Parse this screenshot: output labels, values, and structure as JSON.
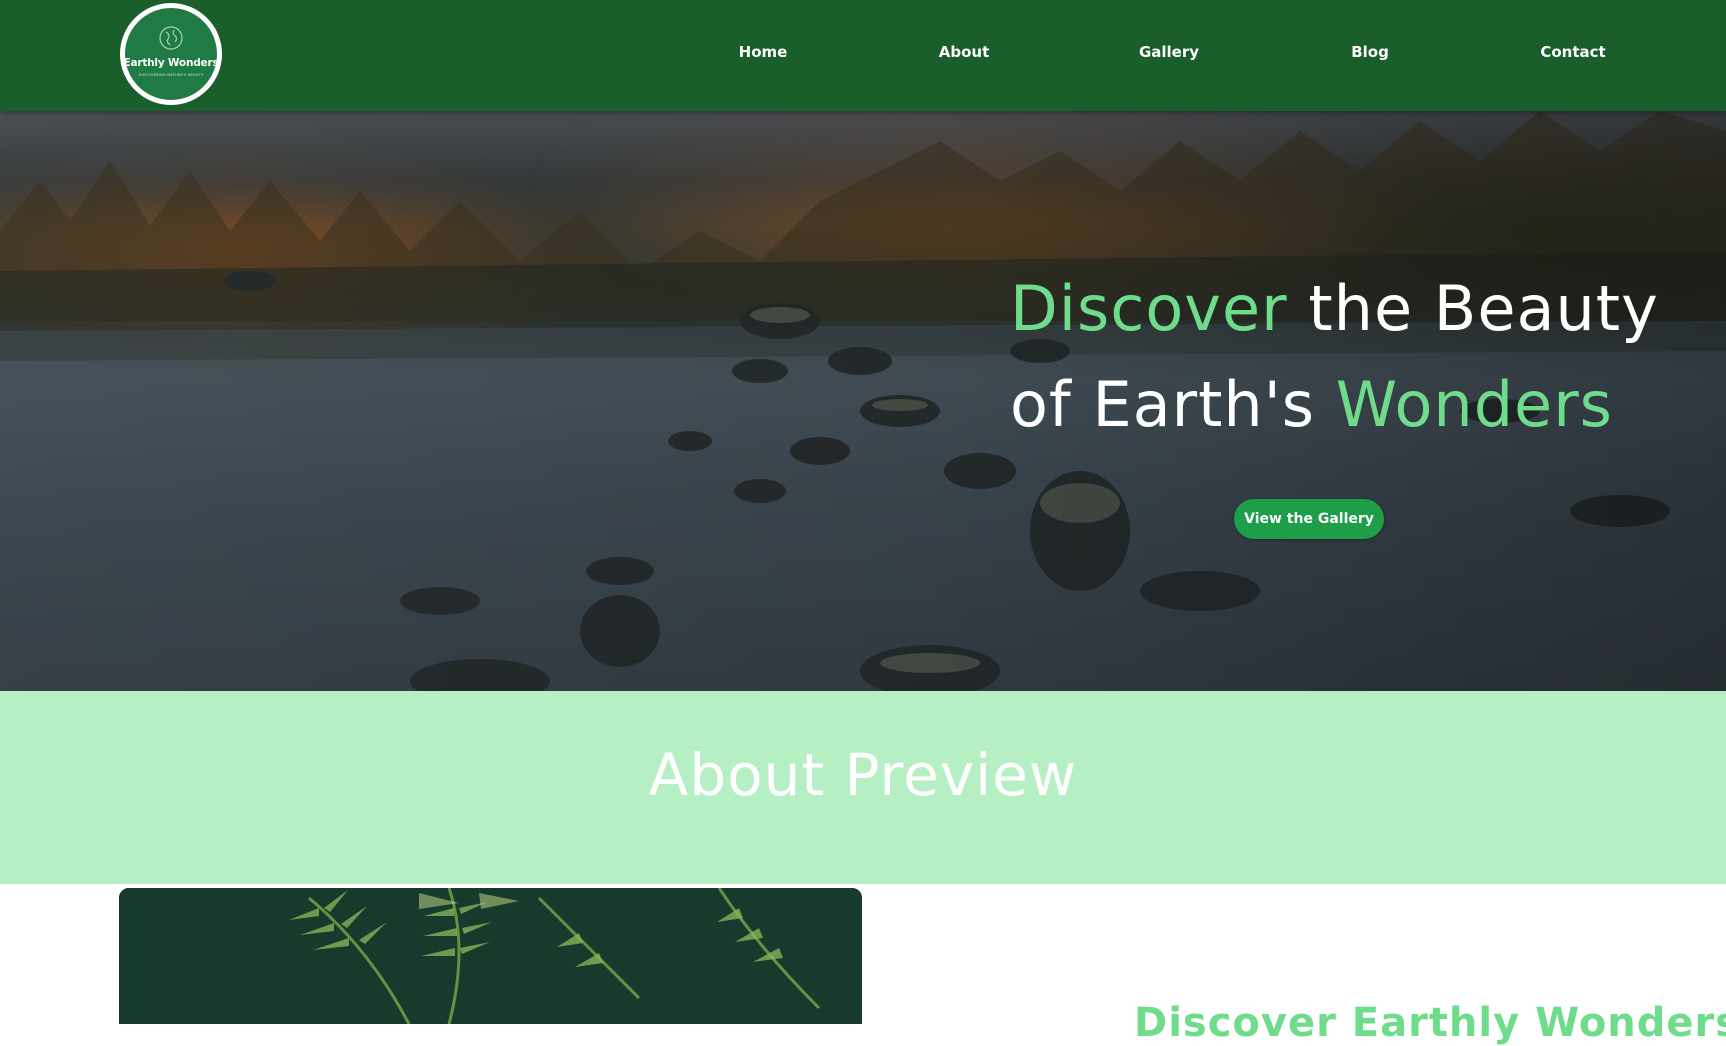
{
  "header": {
    "logo": {
      "name": "Earthly Wonders",
      "tagline": "DISCOVERING NATURE'S BEAUTY",
      "icon": "globe-icon"
    },
    "nav": [
      {
        "label": "Home"
      },
      {
        "label": "About"
      },
      {
        "label": "Gallery"
      },
      {
        "label": "Blog"
      },
      {
        "label": "Contact"
      }
    ]
  },
  "hero": {
    "title": {
      "word1": "Discover",
      "middle": " the Beauty of Earth's ",
      "word2": "Wonders"
    },
    "button_label": "View the Gallery"
  },
  "about": {
    "title": "About Preview",
    "heading": "Discover Earthly Wonders"
  },
  "colors": {
    "header_bg": "#195e2b",
    "accent_green": "#6fdc8c",
    "button_green": "#1e9e48",
    "about_band_bg": "#b6efc4"
  }
}
